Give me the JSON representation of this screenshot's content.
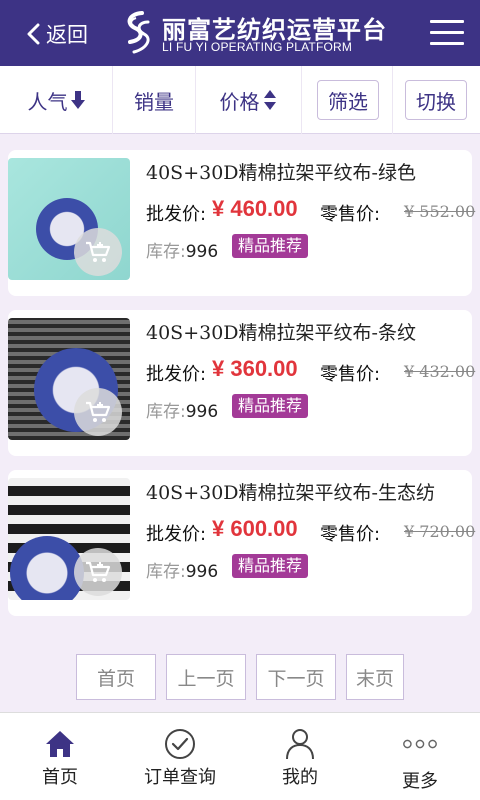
{
  "header": {
    "back_label": "返回",
    "brand_cn": "丽富艺纺织运营平台",
    "brand_en": "LI FU YI OPERATING PLATFORM"
  },
  "sort_bar": {
    "popularity": "人气",
    "sales": "销量",
    "price": "价格",
    "filter": "筛选",
    "switch": "切换"
  },
  "labels": {
    "wholesale": "批发价:",
    "retail": "零售价:",
    "stock": "库存:"
  },
  "products": [
    {
      "title": "40S+30D精棉拉架平纹布-绿色",
      "wholesale_price": "¥ 460.00",
      "retail_price": "¥ 552.00",
      "stock": "996",
      "badge": "精品推荐"
    },
    {
      "title": "40S+30D精棉拉架平纹布-条纹",
      "wholesale_price": "¥ 360.00",
      "retail_price": "¥ 432.00",
      "stock": "996",
      "badge": "精品推荐"
    },
    {
      "title": "40S+30D精棉拉架平纹布-生态纺",
      "wholesale_price": "¥ 600.00",
      "retail_price": "¥ 720.00",
      "stock": "996",
      "badge": "精品推荐"
    }
  ],
  "pagination": {
    "first": "首页",
    "prev": "上一页",
    "next": "下一页",
    "last": "末页"
  },
  "tabbar": {
    "home": "首页",
    "orders": "订单查询",
    "mine": "我的",
    "more": "更多"
  },
  "icons": [
    "back-chevron-icon",
    "brand-logo-icon",
    "menu-icon",
    "arrow-down-icon",
    "sort-updown-icon",
    "cart-add-icon",
    "home-icon",
    "check-circle-icon",
    "user-icon",
    "more-dots-icon"
  ],
  "colors": {
    "brand": "#3d3385",
    "price": "#e1353c",
    "badge": "#a33a97",
    "background": "#f3edf8"
  }
}
